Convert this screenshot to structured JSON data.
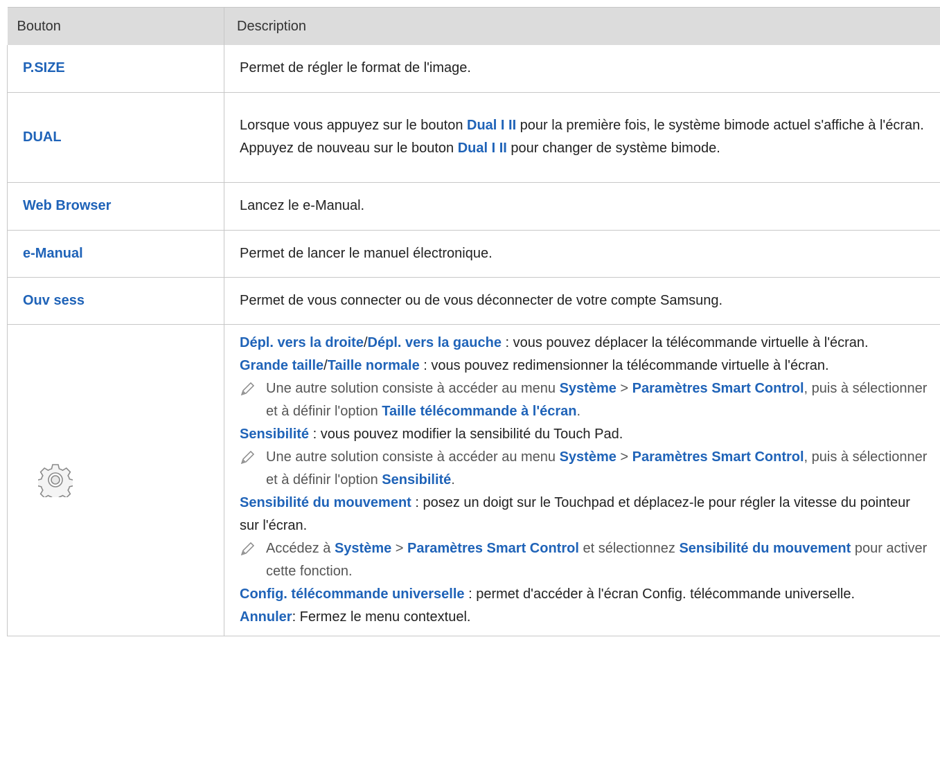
{
  "header": {
    "col1": "Bouton",
    "col2": "Description"
  },
  "rows": [
    {
      "name": "P.SIZE",
      "desc": "Permet de régler le format de l'image."
    },
    {
      "name": "DUAL",
      "desc_a1": "Lorsque vous appuyez sur le bouton ",
      "desc_a_bold": "Dual I II",
      "desc_a2": " pour la première fois, le système bimode actuel s'affiche à l'écran.",
      "desc_b1": "Appuyez de nouveau sur le bouton ",
      "desc_b_bold": "Dual I II",
      "desc_b2": " pour changer de système bimode."
    },
    {
      "name": "Web Browser",
      "desc": "Lancez le e-Manual."
    },
    {
      "name": "e-Manual",
      "desc": "Permet de lancer le manuel électronique."
    },
    {
      "name": "Ouv sess",
      "desc": "Permet de vous connecter ou de vous déconnecter de votre compte Samsung."
    }
  ],
  "settings": {
    "icon": "gear-icon",
    "p1_b1": "Dépl. vers la droite",
    "p1_sep": "/",
    "p1_b2": "Dépl. vers la gauche",
    "p1_text": " : vous pouvez déplacer la télécommande virtuelle à l'écran.",
    "p2_b1": "Grande taille",
    "p2_sep": "/",
    "p2_b2": "Taille normale",
    "p2_text": " : vous pouvez redimensionner la télécommande virtuelle à l'écran.",
    "n1_t1": "Une autre solution consiste à accéder au menu ",
    "n1_b1": "Système",
    "n1_t2": " > ",
    "n1_b2": "Paramètres Smart Control",
    "n1_t3": ", puis à sélectionner et à définir l'option ",
    "n1_b3": "Taille télécommande à l'écran",
    "n1_t4": ".",
    "p3_b": "Sensibilité",
    "p3_text": " : vous pouvez modifier la sensibilité du Touch Pad.",
    "n2_t1": "Une autre solution consiste à accéder au menu ",
    "n2_b1": "Système",
    "n2_t2": " > ",
    "n2_b2": "Paramètres Smart Control",
    "n2_t3": ", puis à sélectionner et à définir l'option ",
    "n2_b3": "Sensibilité",
    "n2_t4": ".",
    "p4_b": "Sensibilité du mouvement",
    "p4_text": " : posez un doigt sur le Touchpad et déplacez-le pour régler la vitesse du pointeur sur l'écran.",
    "n3_t1": "Accédez à ",
    "n3_b1": "Système",
    "n3_t2": " > ",
    "n3_b2": "Paramètres Smart Control",
    "n3_t3": " et sélectionnez ",
    "n3_b3": "Sensibilité du mouvement",
    "n3_t4": " pour activer cette fonction.",
    "p5_b": "Config. télécommande universelle",
    "p5_text": " : permet d'accéder à l'écran Config. télécommande universelle.",
    "p6_b": "Annuler",
    "p6_text": ": Fermez le menu contextuel."
  },
  "colors": {
    "link_blue": "#1f63b8",
    "header_gray": "#dcdcdc",
    "border_gray": "#c7c7c7"
  }
}
